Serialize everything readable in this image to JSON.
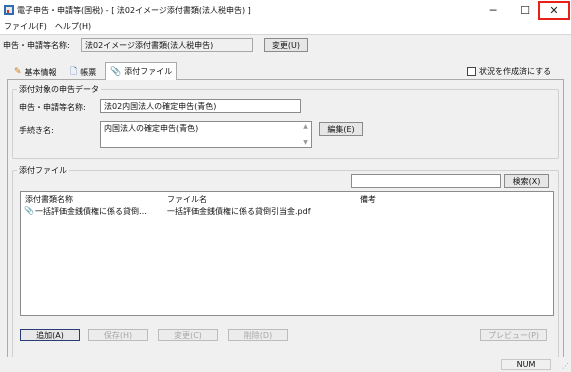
{
  "window": {
    "title": "電子申告・申請等(国税) - [ 法02イメージ添付書類(法人税申告) ]",
    "minimize_glyph": "─",
    "maximize_glyph": "☐",
    "close_glyph": "✕"
  },
  "menu": {
    "items": [
      {
        "label": "ファイル(F)"
      },
      {
        "label": "ヘルプ(H)"
      }
    ]
  },
  "form_name_bar": {
    "label": "申告・申請等名称:",
    "value": "法02イメージ添付書類(法人税申告)",
    "change_button": "変更(U)"
  },
  "tabs": [
    {
      "label": "基本情報",
      "icon": "pencil-icon"
    },
    {
      "label": "帳票",
      "icon": "document-icon"
    },
    {
      "label": "添付ファイル",
      "icon": "paperclip-icon",
      "active": true
    }
  ],
  "create_status_checkbox": {
    "label": "状況を作成済にする",
    "checked": false
  },
  "target_section": {
    "title": "添付対象の申告データ",
    "name_label": "申告・申請等名称:",
    "name_value": "法02内国法人の確定申告(青色)",
    "procedure_label": "手続き名:",
    "procedure_value": "内国法人の確定申告(青色)",
    "edit_button": "編集(E)"
  },
  "attach_section": {
    "title": "添付ファイル",
    "search_value": "",
    "search_button": "検索(X)",
    "columns": [
      "添付書類名称",
      "ファイル名",
      "備考"
    ],
    "rows": [
      {
        "doc_name": "一括評価金銭債権に係る貸倒…",
        "file_name": "一括評価金銭債権に係る貸倒引当金.pdf",
        "note": ""
      }
    ],
    "buttons": {
      "add": "追加(A)",
      "save": "保存(H)",
      "change": "変更(C)",
      "delete": "削除(D)",
      "preview": "プレビュー(P)"
    }
  },
  "statusbar": {
    "num": "NUM"
  },
  "colors": {
    "close_highlight": "#e8201a",
    "active_button_border": "#2a3b7a"
  }
}
